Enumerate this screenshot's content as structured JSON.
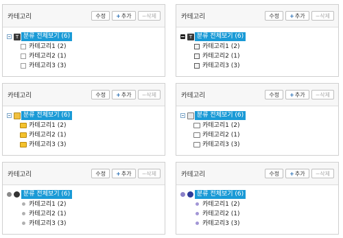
{
  "panels": [
    {
      "title": "카테고리",
      "edit": "수정",
      "add": "추가",
      "delete": "삭제",
      "root": "분류 전체보기 (6)",
      "items": [
        "카테고리1 (2)",
        "카테고리2 (1)",
        "카테고리3 (3)"
      ],
      "toggle_style": "square-minus",
      "root_icon": "T-icon",
      "child_icon": "page-icon"
    },
    {
      "title": "카테고리",
      "edit": "수정",
      "add": "추가",
      "delete": "삭제",
      "root": "분류 전체보기 (6)",
      "items": [
        "카테고리1 (2)",
        "카테고리2 (1)",
        "카테고리3 (3)"
      ],
      "toggle_style": "black-minus",
      "root_icon": "T-icon",
      "child_icon": "page-icon"
    },
    {
      "title": "카테고리",
      "edit": "수정",
      "add": "추가",
      "delete": "삭제",
      "root": "분류 전체보기 (6)",
      "items": [
        "카테고리1 (2)",
        "카테고리2 (1)",
        "카테고리3 (3)"
      ],
      "toggle_style": "square-minus",
      "root_icon": "book-icon",
      "child_icon": "folder-icon"
    },
    {
      "title": "카테고리",
      "edit": "수정",
      "add": "추가",
      "delete": "삭제",
      "root": "분류 전체보기 (6)",
      "items": [
        "카테고리1 (2)",
        "카테고리2 (1)",
        "카테고리3 (3)"
      ],
      "toggle_style": "square-minus",
      "root_icon": "box-icon",
      "child_icon": "folder-outline-icon"
    },
    {
      "title": "카테고리",
      "edit": "수정",
      "add": "추가",
      "delete": "삭제",
      "root": "분류 전체보기 (6)",
      "items": [
        "카테고리1 (2)",
        "카테고리2 (1)",
        "카테고리3 (3)"
      ],
      "toggle_style": "gray-circle",
      "root_icon": "dot-icon",
      "child_icon": "gray-dot-icon"
    },
    {
      "title": "카테고리",
      "edit": "수정",
      "add": "추가",
      "delete": "삭제",
      "root": "분류 전체보기 (6)",
      "items": [
        "카테고리1 (2)",
        "카테고리2 (1)",
        "카테고리3 (3)"
      ],
      "toggle_style": "purple-circle",
      "root_icon": "dot-icon",
      "child_icon": "purple-dot-icon"
    }
  ],
  "colors": {
    "selected_bg": "#1a9ad6",
    "border": "#cfcfcf",
    "header_bg": "#f7f7f7"
  }
}
